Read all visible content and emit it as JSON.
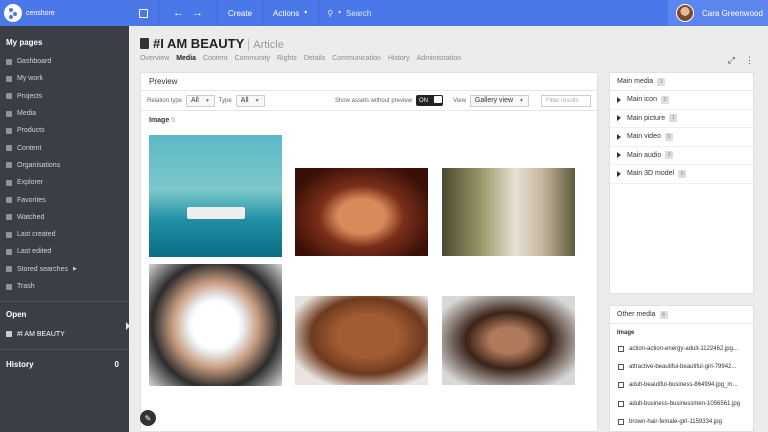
{
  "app": {
    "logo_text": "censhore"
  },
  "topbar": {
    "create_label": "Create",
    "actions_label": "Actions",
    "search_placeholder": "Search",
    "user_name": "Cara Greenwood"
  },
  "sidebar": {
    "heading": "My pages",
    "items": [
      {
        "label": "Dashboard",
        "icon": "dashboard-icon"
      },
      {
        "label": "My work",
        "icon": "user-icon"
      },
      {
        "label": "Projects",
        "icon": "projects-icon"
      },
      {
        "label": "Media",
        "icon": "media-icon"
      },
      {
        "label": "Products",
        "icon": "products-icon"
      },
      {
        "label": "Content",
        "icon": "content-icon"
      },
      {
        "label": "Organisations",
        "icon": "globe-icon"
      },
      {
        "label": "Explorer",
        "icon": "explorer-icon"
      },
      {
        "label": "Favorites",
        "icon": "heart-icon"
      },
      {
        "label": "Watched",
        "icon": "eye-icon"
      },
      {
        "label": "Last created",
        "icon": "file-icon"
      },
      {
        "label": "Last edited",
        "icon": "edit-icon"
      },
      {
        "label": "Stored searches",
        "icon": "search-icon"
      },
      {
        "label": "Trash",
        "icon": "trash-icon"
      }
    ],
    "open_heading": "Open",
    "open_item": "#I AM BEAUTY",
    "history_heading": "History",
    "history_count": "0"
  },
  "header": {
    "title": "#I AM BEAUTY",
    "type": "Article",
    "tabs": [
      "Overview",
      "Media",
      "Content",
      "Community",
      "Rights",
      "Details",
      "Communication",
      "History",
      "Administration"
    ],
    "active_tab": "Media"
  },
  "preview": {
    "title": "Preview",
    "relation_type_label": "Relation type",
    "relation_type_value": "All",
    "type_label": "Type",
    "type_value": "All",
    "show_assets_label": "Show assets without preview",
    "toggle_value": "ON",
    "view_label": "View",
    "view_value": "Gallery view",
    "filter_placeholder": "Filter results",
    "image_heading": "Image",
    "image_count": "6"
  },
  "main_media": {
    "title": "Main media",
    "title_badge": "1",
    "rows": [
      {
        "label": "Main icon",
        "badge": "0"
      },
      {
        "label": "Main picture",
        "badge": "1"
      },
      {
        "label": "Main video",
        "badge": "0"
      },
      {
        "label": "Main audio",
        "badge": "0"
      },
      {
        "label": "Main 3D model",
        "badge": "0"
      }
    ]
  },
  "other_media": {
    "title": "Other media",
    "title_badge": "6",
    "subheading": "Image",
    "files": [
      "action-action-energy-adult-1122462.jpg...",
      "attractive-beautiful-beautiful-girl-79942...",
      "adult-beautiful-business-864994.jpg_m...",
      "adult-business-businessmen-1056561.jpg",
      "brown-hair-female-girl-1159334.jpg"
    ]
  }
}
